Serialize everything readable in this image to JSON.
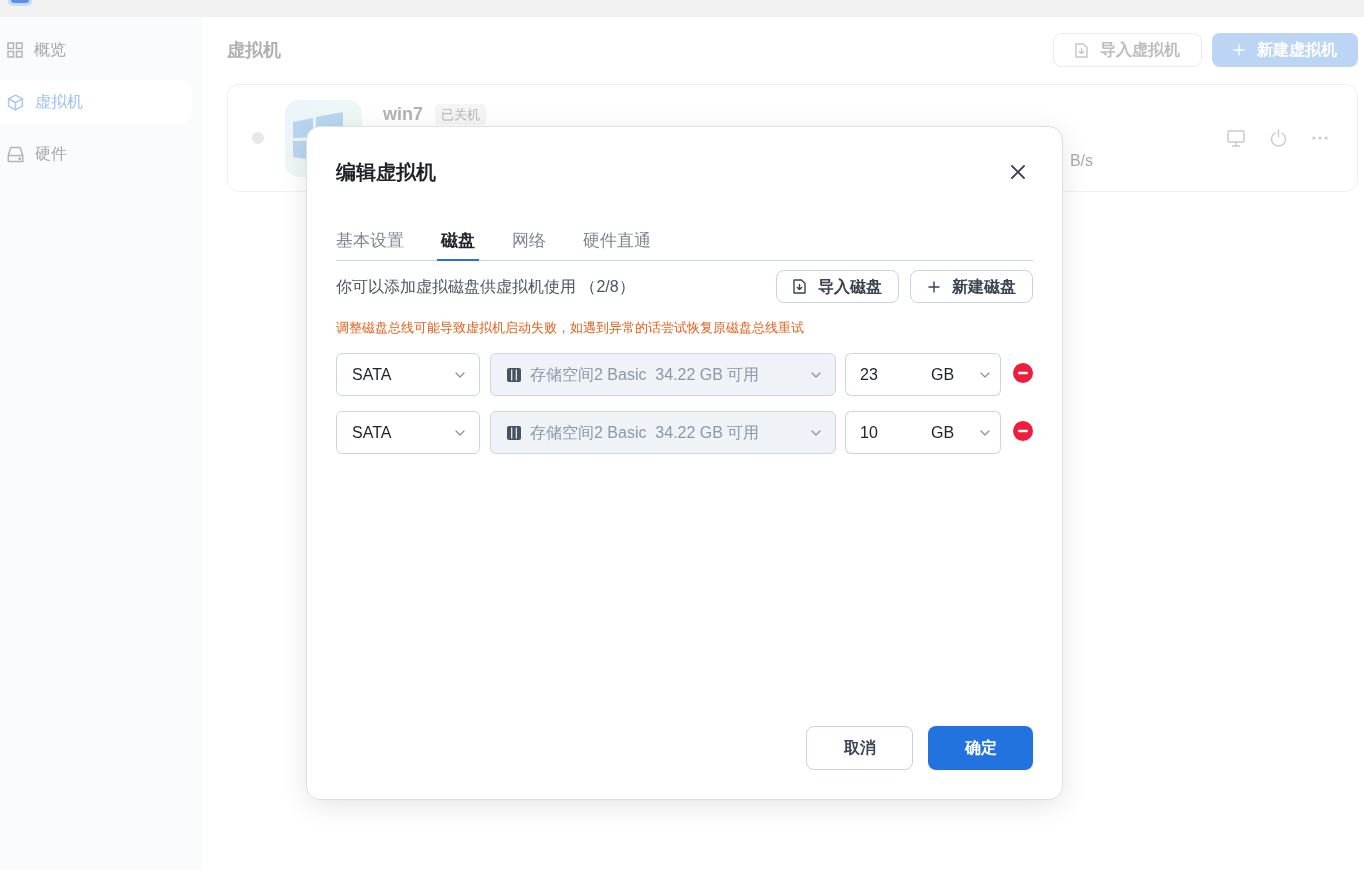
{
  "sidebar": {
    "items": [
      {
        "label": "概览",
        "selected": false
      },
      {
        "label": "虚拟机",
        "selected": true
      },
      {
        "label": "硬件",
        "selected": false
      }
    ]
  },
  "header": {
    "title": "虚拟机",
    "buttons": [
      {
        "label": "导入虚拟机",
        "kind": "import"
      },
      {
        "label": "新建虚拟机",
        "kind": "create"
      }
    ]
  },
  "vm": {
    "running": false,
    "name": "win7",
    "status": "已关机",
    "stat": "B/s"
  },
  "dialog": {
    "title": "编辑虚拟机",
    "tabs": [
      {
        "label": "基本设置",
        "selected": false
      },
      {
        "label": "磁盘",
        "selected": true
      },
      {
        "label": "网络",
        "selected": false
      },
      {
        "label": "硬件直通",
        "selected": false
      }
    ],
    "description": "你可以添加虚拟磁盘供虚拟机使用 （2/8）",
    "buttons": [
      {
        "label": "导入磁盘",
        "kind": "import"
      },
      {
        "label": "新建磁盘",
        "kind": "create"
      }
    ],
    "warning": "调整磁盘总线可能导致虚拟机启动失败，如遇到异常的话尝试恢复原磁盘总线重试",
    "disks": [
      {
        "bus": "SATA",
        "storage": {
          "text": "存储空间2 Basic  34.22 GB 可用",
          "disabled": true
        },
        "size": "23",
        "unit": "GB"
      },
      {
        "bus": "SATA",
        "storage": {
          "text": "存储空间2 Basic  34.22 GB 可用",
          "disabled": true
        },
        "size": "10",
        "unit": "GB"
      }
    ],
    "footer_buttons": [
      {
        "label": "取消",
        "kind": "secondary"
      },
      {
        "label": "确定",
        "kind": "primary"
      }
    ]
  }
}
